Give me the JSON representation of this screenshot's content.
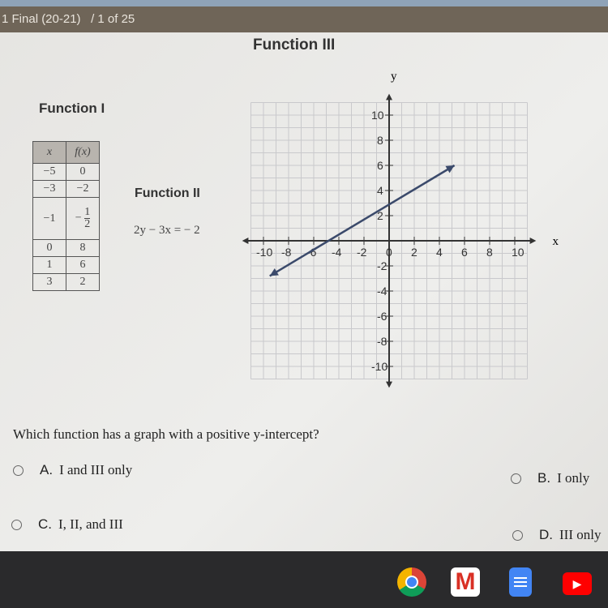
{
  "header": {
    "title": "1 Final (20-21)",
    "progress": "/ 1 of 25"
  },
  "function3": {
    "title": "Function III"
  },
  "function1": {
    "title": "Function I",
    "headers": [
      "x",
      "f(x)"
    ],
    "rows": [
      [
        "−5",
        "0"
      ],
      [
        "−3",
        "−2"
      ],
      [
        "−1",
        {
          "sign": "−",
          "num": "1",
          "den": "2"
        }
      ],
      [
        "0",
        "8"
      ],
      [
        "1",
        "6"
      ],
      [
        "3",
        "2"
      ]
    ]
  },
  "function2": {
    "title": "Function II",
    "equation": "2y − 3x = − 2"
  },
  "chart_data": {
    "type": "line",
    "xlabel": "x",
    "ylabel": "y",
    "xlim": [
      -10,
      10
    ],
    "ylim": [
      -10,
      10
    ],
    "grid": true,
    "xticks": [
      "-10",
      "-8",
      "-6",
      "-4",
      "-2",
      "0",
      "2",
      "4",
      "6",
      "8",
      "10"
    ],
    "yticks": [
      "10",
      "8",
      "6",
      "4",
      "2",
      "-2",
      "-4",
      "-6",
      "-8",
      "-10"
    ],
    "series": [
      {
        "x": [
          -9.5,
          5.2
        ],
        "y": [
          -2.8,
          6
        ],
        "arrows": true
      }
    ],
    "line_color": "#3b4a6b"
  },
  "question": "Which function has a graph with a positive y-intercept?",
  "options": [
    {
      "letter": "A.",
      "text": "I and III only"
    },
    {
      "letter": "B.",
      "text": "I only"
    },
    {
      "letter": "C.",
      "text": "I, II, and III"
    },
    {
      "letter": "D.",
      "text": "III only"
    }
  ],
  "taskbar": {
    "icons": [
      "chrome-icon",
      "gmail-icon",
      "docs-icon",
      "youtube-icon"
    ]
  }
}
